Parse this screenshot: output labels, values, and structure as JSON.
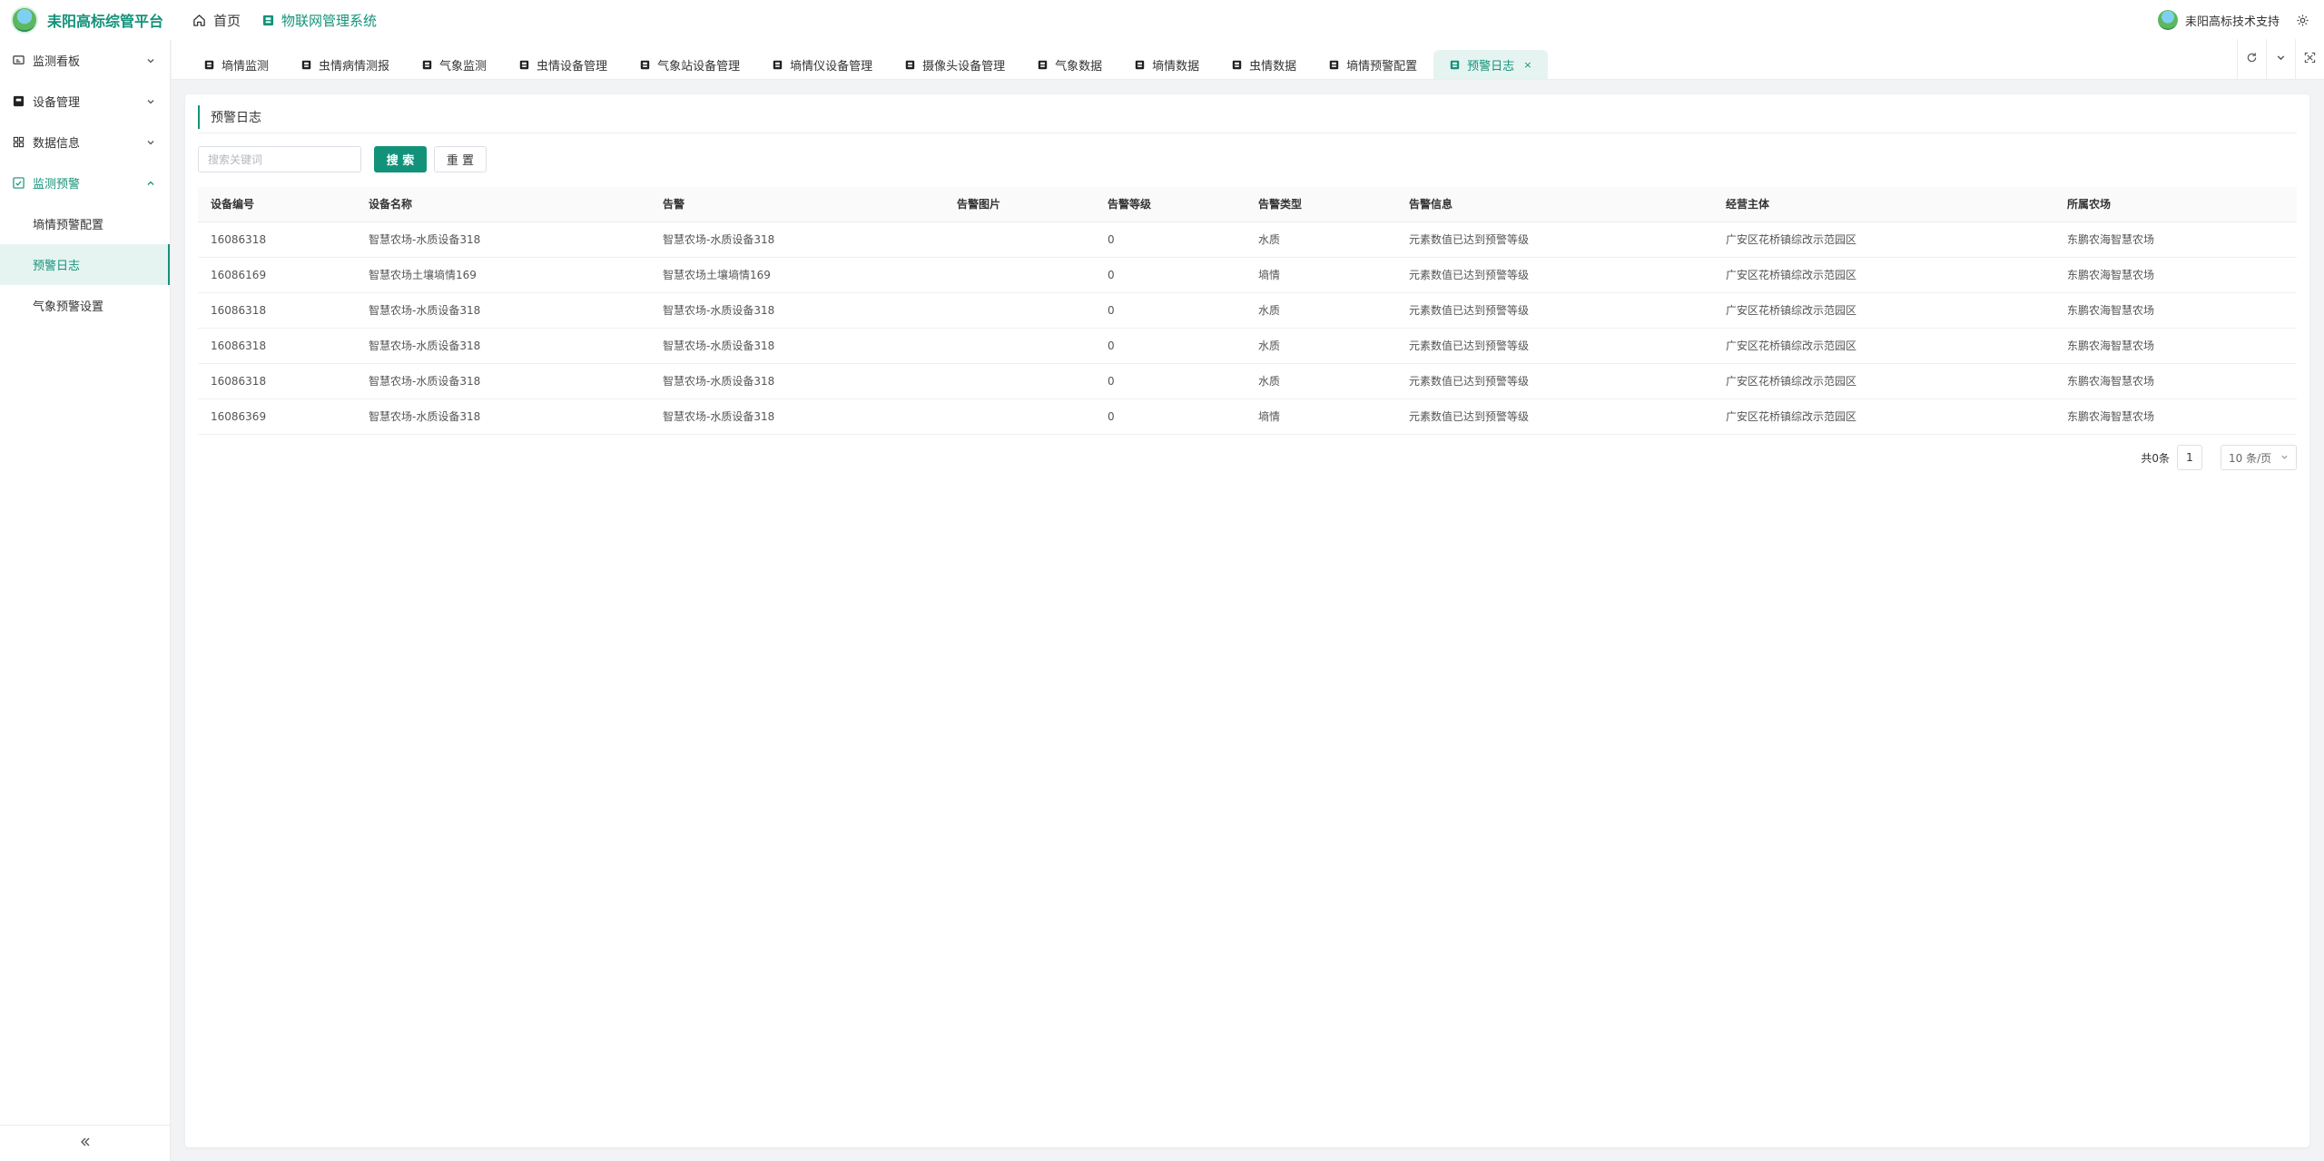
{
  "brand": {
    "name": "耒阳高标综管平台"
  },
  "topnav": [
    {
      "label": "首页",
      "icon": "home-icon",
      "active": false
    },
    {
      "label": "物联网管理系统",
      "icon": "module-icon",
      "active": true
    }
  ],
  "user": {
    "name": "耒阳高标技术支持"
  },
  "sidebar": {
    "items": [
      {
        "label": "监测看板",
        "icon": "monitor-board-icon"
      },
      {
        "label": "设备管理",
        "icon": "device-icon"
      },
      {
        "label": "数据信息",
        "icon": "data-icon"
      },
      {
        "label": "监测预警",
        "icon": "alert-icon"
      }
    ],
    "sub_items": [
      {
        "label": "墒情预警配置"
      },
      {
        "label": "预警日志"
      },
      {
        "label": "气象预警设置"
      }
    ]
  },
  "tabs": [
    {
      "label": "墒情监测"
    },
    {
      "label": "虫情病情测报"
    },
    {
      "label": "气象监测"
    },
    {
      "label": "虫情设备管理"
    },
    {
      "label": "气象站设备管理"
    },
    {
      "label": "墒情仪设备管理"
    },
    {
      "label": "摄像头设备管理"
    },
    {
      "label": "气象数据"
    },
    {
      "label": "墒情数据"
    },
    {
      "label": "虫情数据"
    },
    {
      "label": "墒情预警配置"
    },
    {
      "label": "预警日志",
      "active": true,
      "close": "×"
    }
  ],
  "page": {
    "title": "预警日志"
  },
  "search": {
    "placeholder": "搜索关键词",
    "value": "",
    "search_label": "搜 索",
    "reset_label": "重 置"
  },
  "table": {
    "columns": [
      "设备编号",
      "设备名称",
      "告警",
      "告警图片",
      "告警等级",
      "告警类型",
      "告警信息",
      "经营主体",
      "所属农场"
    ],
    "rows": [
      [
        "16086318",
        "智慧农场-水质设备318",
        "智慧农场-水质设备318",
        "",
        "0",
        "水质",
        "元素数值已达到预警等级",
        "广安区花桥镇综改示范园区",
        "东鹏农海智慧农场"
      ],
      [
        "16086169",
        "智慧农场土壤墒情169",
        "智慧农场土壤墒情169",
        "",
        "0",
        "墒情",
        "元素数值已达到预警等级",
        "广安区花桥镇综改示范园区",
        "东鹏农海智慧农场"
      ],
      [
        "16086318",
        "智慧农场-水质设备318",
        "智慧农场-水质设备318",
        "",
        "0",
        "水质",
        "元素数值已达到预警等级",
        "广安区花桥镇综改示范园区",
        "东鹏农海智慧农场"
      ],
      [
        "16086318",
        "智慧农场-水质设备318",
        "智慧农场-水质设备318",
        "",
        "0",
        "水质",
        "元素数值已达到预警等级",
        "广安区花桥镇综改示范园区",
        "东鹏农海智慧农场"
      ],
      [
        "16086318",
        "智慧农场-水质设备318",
        "智慧农场-水质设备318",
        "",
        "0",
        "水质",
        "元素数值已达到预警等级",
        "广安区花桥镇综改示范园区",
        "东鹏农海智慧农场"
      ],
      [
        "16086369",
        "智慧农场-水质设备318",
        "智慧农场-水质设备318",
        "",
        "0",
        "墒情",
        "元素数值已达到预警等级",
        "广安区花桥镇综改示范园区",
        "东鹏农海智慧农场"
      ]
    ]
  },
  "pagination": {
    "total_text": "共0条",
    "current_page": "1",
    "page_size": "10 条/页"
  },
  "colors": {
    "accent": "#13927a",
    "active_bg": "#e6f4f1"
  }
}
